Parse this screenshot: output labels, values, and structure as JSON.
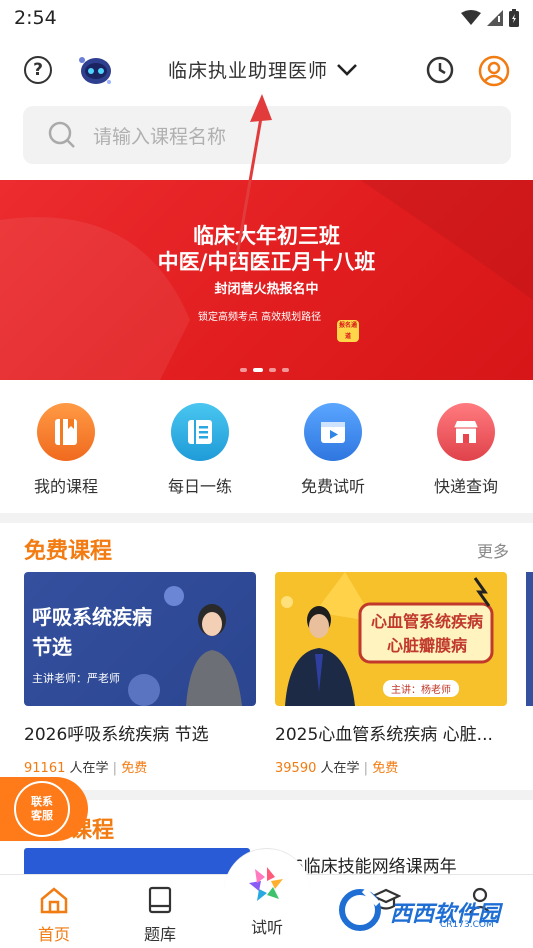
{
  "status": {
    "time": "2:54"
  },
  "header": {
    "title": "临床执业助理医师"
  },
  "search": {
    "placeholder": "请输入课程名称"
  },
  "banner": {
    "line1": "临床大年初三班",
    "line2": "中医/中西医正月十八班",
    "line3": "封闭营火热报名中",
    "line4": "锁定高频考点   高效规划路径",
    "badge": "报名通道"
  },
  "quick_nav": [
    {
      "label": "我的课程",
      "icon": "book-icon",
      "color": "#f47b20"
    },
    {
      "label": "每日一练",
      "icon": "ticket-icon",
      "color": "#2aa6e0"
    },
    {
      "label": "免费试听",
      "icon": "video-icon",
      "color": "#2f86e6"
    },
    {
      "label": "快递查询",
      "icon": "store-icon",
      "color": "#e8454c"
    }
  ],
  "free_courses": {
    "title": "免费课程",
    "more": "更多",
    "items": [
      {
        "thumb_title": "呼吸系统疾病\n节选",
        "thumb_title_a": "呼吸系统疾病",
        "thumb_title_b": "节选",
        "thumb_teacher": "主讲老师：严老师",
        "name": "2026呼吸系统疾病 节选",
        "count": "91161",
        "learning": "人在学",
        "sep": "|",
        "free": "免费"
      },
      {
        "thumb_title_a": "心血管系统疾病",
        "thumb_title_b": "心脏瓣膜病",
        "thumb_teacher": "主讲：杨老师",
        "name": "2025心血管系统疾病 心脏...",
        "count": "39590",
        "learning": "人在学",
        "sep": "|",
        "free": "免费"
      }
    ]
  },
  "second_section": {
    "title_partial": "课程",
    "course_partial": "26临床技能网络课两年"
  },
  "customer_service": {
    "label_a": "联系",
    "label_b": "客服"
  },
  "bottom_nav": [
    {
      "label": "首页",
      "icon": "home-icon",
      "active": true
    },
    {
      "label": "题库",
      "icon": "question-bank-icon",
      "active": false
    },
    {
      "label": "试听",
      "icon": "audition-icon",
      "active": false
    },
    {
      "label": "",
      "icon": "graduation-cap-icon",
      "active": false
    },
    {
      "label": "",
      "icon": "profile-icon",
      "active": false
    }
  ],
  "watermark": {
    "text": "西西软件园",
    "sub": "CR173.COM"
  },
  "colors": {
    "accent": "#f27b12",
    "banner_red": "#e11d1f"
  }
}
